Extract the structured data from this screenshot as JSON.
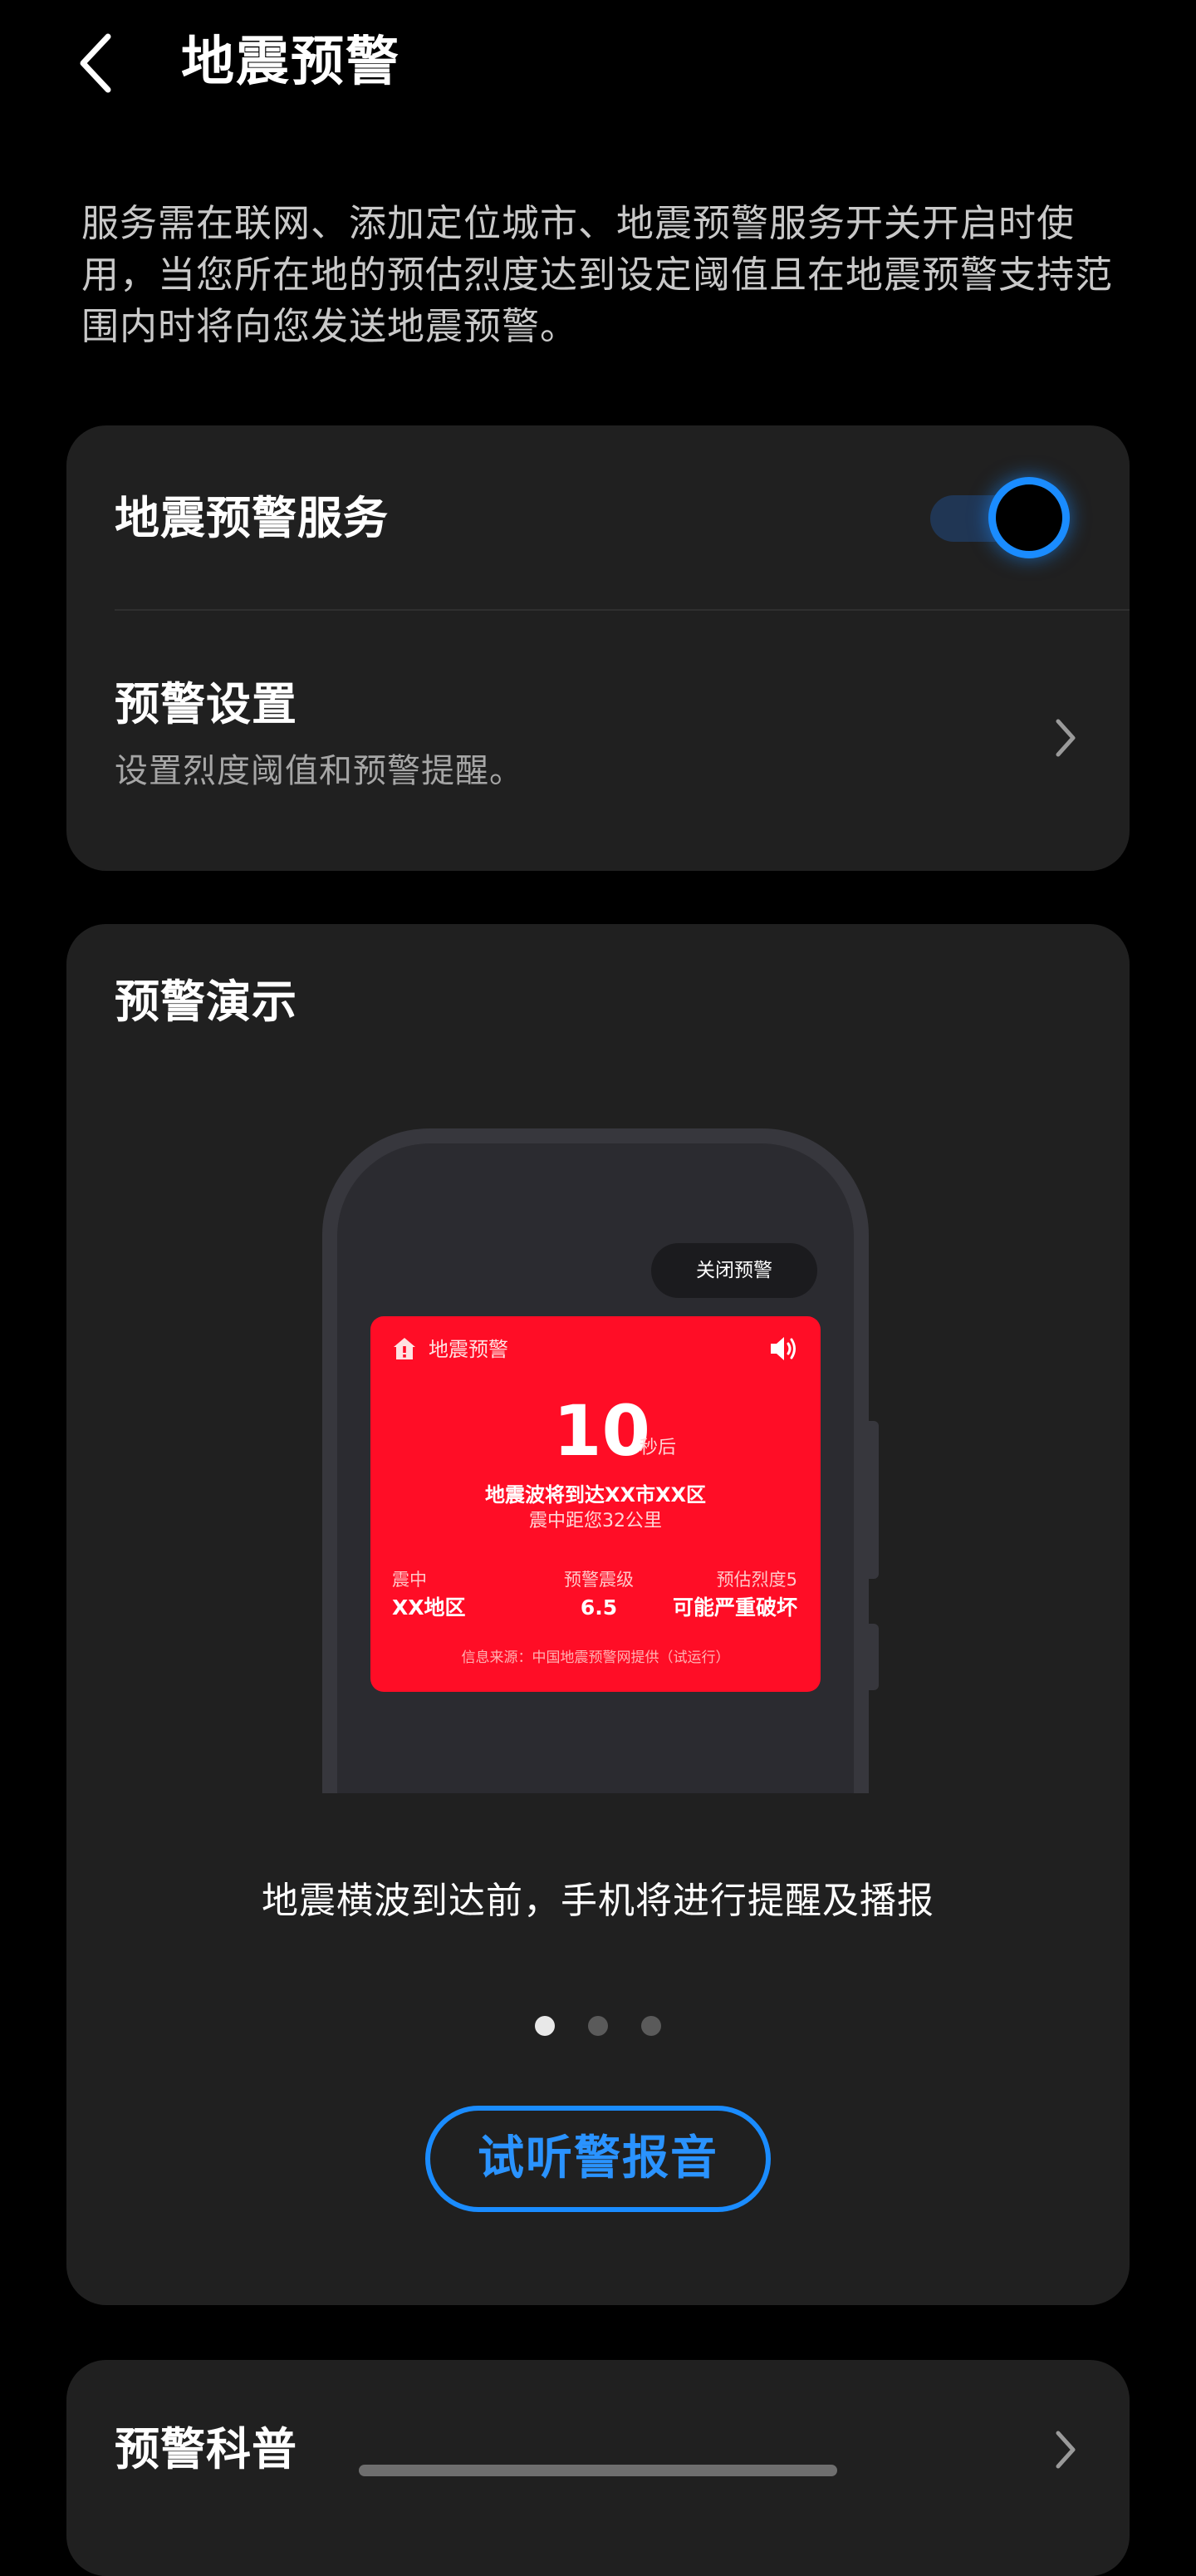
{
  "header": {
    "title": "地震预警",
    "back_icon": "chevron-left-icon"
  },
  "description": "服务需在联网、添加定位城市、地震预警服务开关开启时使用，当您所在地的预估烈度达到设定阈值且在地震预警支持范围内时将向您发送地震预警。",
  "service_card": {
    "service_label": "地震预警服务",
    "service_toggle_on": true,
    "settings_label": "预警设置",
    "settings_sub": "设置烈度阈值和预警提醒。"
  },
  "demo": {
    "title": "预警演示",
    "phone": {
      "close_button": "关闭预警",
      "alert_title": "地震预警",
      "countdown": "10",
      "countdown_unit": "秒后",
      "line1": "地震波将到达XX市XX区",
      "line2": "震中距您32公里",
      "epicenter_label": "震中",
      "epicenter_value": "XX地区",
      "magnitude_label": "预警震级",
      "magnitude_value": "6.5",
      "intensity_label": "预估烈度5",
      "intensity_value": "可能严重破坏",
      "source": "信息来源：中国地震预警网提供（试运行）"
    },
    "caption": "地震横波到达前，手机将进行提醒及播报",
    "pager": {
      "count": 3,
      "active": 0
    },
    "listen_button": "试听警报音"
  },
  "science_card": {
    "label": "预警科普"
  },
  "colors": {
    "accent": "#1a8cff",
    "alert_red": "#ff0d26",
    "card_bg": "#202020",
    "page_bg": "#000000"
  }
}
